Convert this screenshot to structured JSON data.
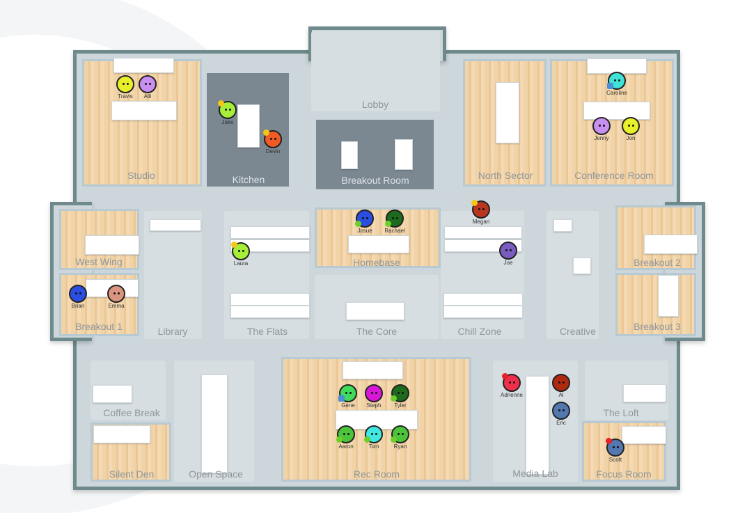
{
  "rooms": [
    "Studio",
    "Kitchen",
    "Lobby",
    "Breakout Room",
    "North Sector",
    "Conference Room",
    "West Wing",
    "Breakout 1",
    "Library",
    "The Flats",
    "Homebase",
    "The Core",
    "Chill Zone",
    "Creative",
    "Breakout 2",
    "Breakout 3",
    "Coffee Break",
    "Silent Den",
    "Open Space",
    "Rec Room",
    "Media Lab",
    "The Loft",
    "Focus Room"
  ],
  "people": [
    {
      "name": "Travis",
      "color": "#e8f02a"
    },
    {
      "name": "Alli",
      "color": "#c98ff0"
    },
    {
      "name": "Jake",
      "color": "#a6ee3a",
      "badge": "away"
    },
    {
      "name": "Devin",
      "color": "#f05a24",
      "badge": "away"
    },
    {
      "name": "Caroline",
      "color": "#3fe3d8",
      "badge": "screen"
    },
    {
      "name": "Jenny",
      "color": "#c98ff0"
    },
    {
      "name": "Jon",
      "color": "#e8f02a"
    },
    {
      "name": "Josue",
      "color": "#2a4ee0",
      "badge": "active"
    },
    {
      "name": "Rachael",
      "color": "#1d6b1d",
      "badge": "active"
    },
    {
      "name": "Megan",
      "color": "#b8361f",
      "badge": "away"
    },
    {
      "name": "Laura",
      "color": "#a6ee3a",
      "badge": "away"
    },
    {
      "name": "Joe",
      "color": "#7a5cc0"
    },
    {
      "name": "Brian",
      "color": "#2a4ee0"
    },
    {
      "name": "Emma",
      "color": "#d9957f"
    },
    {
      "name": "Gene",
      "color": "#3fdc5a",
      "badge": "screen"
    },
    {
      "name": "Steph",
      "color": "#d816d8"
    },
    {
      "name": "Tyler",
      "color": "#1d6b1d",
      "badge": "active"
    },
    {
      "name": "Aaron",
      "color": "#4cc43a",
      "badge": "active"
    },
    {
      "name": "Tom",
      "color": "#3fe8e0",
      "badge": "active"
    },
    {
      "name": "Ryan",
      "color": "#4cc43a",
      "badge": "active"
    },
    {
      "name": "Adrienne",
      "color": "#ee2f4c",
      "badge": "busy"
    },
    {
      "name": "Al",
      "color": "#b02a10"
    },
    {
      "name": "Eric",
      "color": "#5378b0"
    },
    {
      "name": "Scott",
      "color": "#5378b0",
      "badge": "dnd"
    }
  ],
  "badge_colors": {
    "away": "#f5c518",
    "active": "#6ccf2a",
    "busy": "#e8202a",
    "dnd": "#e8202a",
    "screen": "#4a90d9"
  }
}
